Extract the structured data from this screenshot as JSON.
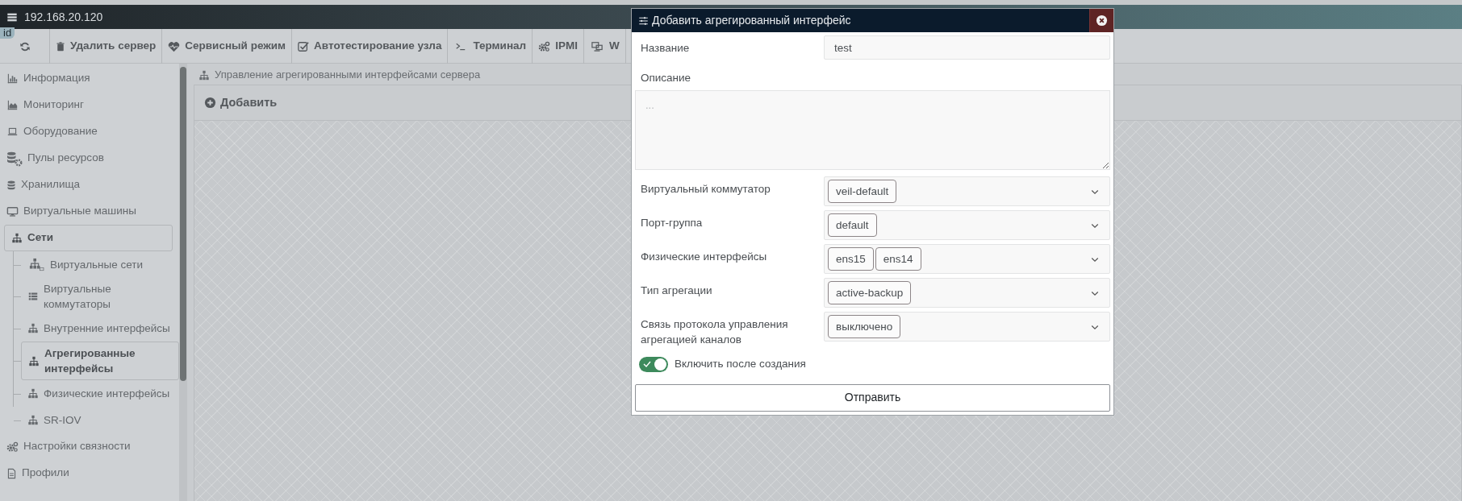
{
  "window": {
    "title": "192.168.20.120",
    "badge": "id"
  },
  "toolbar": [
    {
      "label": "Удалить сервер"
    },
    {
      "label": "Сервисный режим"
    },
    {
      "label": "Автотестирование узла"
    },
    {
      "label": "Терминал"
    },
    {
      "label": "IPMI"
    },
    {
      "label": "W"
    }
  ],
  "sidebar": {
    "items": [
      {
        "label": "Информация",
        "selected": false
      },
      {
        "label": "Мониторинг",
        "selected": false
      },
      {
        "label": "Оборудование",
        "selected": false
      },
      {
        "label": "Пулы ресурсов",
        "selected": false
      },
      {
        "label": "Хранилища",
        "selected": false
      },
      {
        "label": "Виртуальные машины",
        "selected": false
      },
      {
        "label": "Сети",
        "selected": true,
        "children": [
          {
            "label": "Виртуальные сети",
            "selected": false
          },
          {
            "label": "Виртуальные коммутаторы",
            "selected": false
          },
          {
            "label": "Внутренние интерфейсы",
            "selected": false
          },
          {
            "label": "Агрегированные интерфейсы",
            "selected": true
          },
          {
            "label": "Физические интерфейсы",
            "selected": false
          },
          {
            "label": "SR-IOV",
            "selected": false
          }
        ]
      },
      {
        "label": "Настройки связности",
        "selected": false
      },
      {
        "label": "Профили",
        "selected": false
      }
    ]
  },
  "content": {
    "breadcrumb": "Управление агрегированными интерфейсами сервера",
    "add_button": "Добавить"
  },
  "dialog": {
    "title": "Добавить агрегированный интерфейс",
    "fields": [
      {
        "kind": "input",
        "label": "Название",
        "value": "test"
      },
      {
        "kind": "textarea",
        "label": "Описание",
        "placeholder": "..."
      },
      {
        "kind": "select",
        "label": "Виртуальный коммутатор",
        "tags": [
          "veil-default"
        ]
      },
      {
        "kind": "select",
        "label": "Порт-группа",
        "tags": [
          "default"
        ]
      },
      {
        "kind": "select",
        "label": "Физические интерфейсы",
        "tags": [
          "ens15",
          "ens14"
        ]
      },
      {
        "kind": "select",
        "label": "Тип агрегации",
        "tags": [
          "active-backup"
        ]
      },
      {
        "kind": "select",
        "label": "Связь протокола управления агрегацией каналов",
        "tags": [
          "выключено"
        ]
      }
    ],
    "toggle": {
      "label": "Включить после создания",
      "on": true
    },
    "submit": "Отправить"
  }
}
